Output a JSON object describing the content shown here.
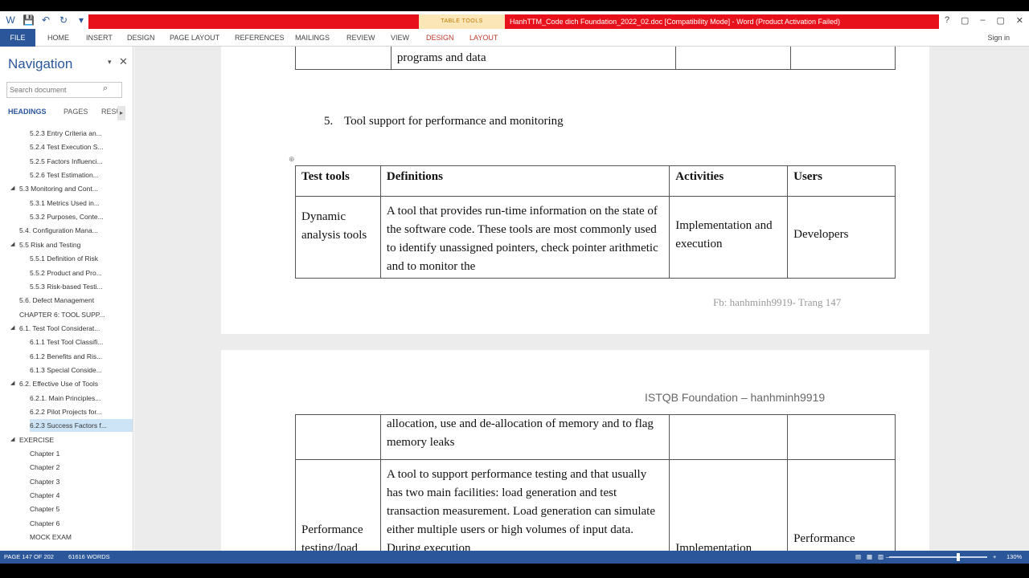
{
  "window": {
    "quick_access": [
      "W",
      "💾",
      "↶",
      "↻",
      "▾"
    ],
    "context_tab_group": "TABLE TOOLS",
    "title": "HanhTTM_Code dich Foundation_2022_02.doc [Compatibility Mode] - Word (Product Activation Failed)",
    "controls": [
      "?",
      "▢",
      "–",
      "▢",
      "✕"
    ]
  },
  "ribbon": {
    "file": "FILE",
    "tabs": [
      "HOME",
      "INSERT",
      "DESIGN",
      "PAGE LAYOUT",
      "REFERENCES",
      "MAILINGS",
      "REVIEW",
      "VIEW"
    ],
    "context_tabs": [
      "DESIGN",
      "LAYOUT"
    ],
    "signin": "Sign in"
  },
  "navigation": {
    "title": "Navigation",
    "pin": "▾",
    "close": "✕",
    "search_placeholder": "Search document",
    "tabs": [
      "HEADINGS",
      "PAGES",
      "RESU"
    ],
    "items": [
      {
        "label": "5.2.3 Entry Criteria an...",
        "level": 2,
        "tri": ""
      },
      {
        "label": "5.2.4 Test Execution S...",
        "level": 2,
        "tri": ""
      },
      {
        "label": "5.2.5 Factors Influenci...",
        "level": 2,
        "tri": ""
      },
      {
        "label": "5.2.6 Test Estimation...",
        "level": 2,
        "tri": ""
      },
      {
        "label": "5.3 Monitoring and Cont...",
        "level": 1,
        "tri": "◢"
      },
      {
        "label": "5.3.1 Metrics Used in...",
        "level": 2,
        "tri": ""
      },
      {
        "label": "5.3.2 Purposes, Conte...",
        "level": 2,
        "tri": ""
      },
      {
        "label": "5.4. Configuration Mana...",
        "level": 1,
        "tri": ""
      },
      {
        "label": "5.5 Risk and Testing",
        "level": 1,
        "tri": "◢"
      },
      {
        "label": "5.5.1 Definition of Risk",
        "level": 2,
        "tri": ""
      },
      {
        "label": "5.5.2 Product and Pro...",
        "level": 2,
        "tri": ""
      },
      {
        "label": "5.5.3 Risk-based Testi...",
        "level": 2,
        "tri": ""
      },
      {
        "label": "5.6. Defect Management",
        "level": 1,
        "tri": ""
      },
      {
        "label": "CHAPTER 6: TOOL SUPP...",
        "level": 1,
        "tri": ""
      },
      {
        "label": "6.1. Test Tool Considerat...",
        "level": 1,
        "tri": "◢"
      },
      {
        "label": "6.1.1 Test Tool Classifi...",
        "level": 2,
        "tri": ""
      },
      {
        "label": "6.1.2 Benefits and Ris...",
        "level": 2,
        "tri": ""
      },
      {
        "label": "6.1.3 Special Conside...",
        "level": 2,
        "tri": ""
      },
      {
        "label": "6.2. Effective Use of Tools",
        "level": 1,
        "tri": "◢"
      },
      {
        "label": "6.2.1. Main Principles...",
        "level": 2,
        "tri": ""
      },
      {
        "label": "6.2.2 Pilot Projects for...",
        "level": 2,
        "tri": ""
      },
      {
        "label": "6.2.3 Success Factors f...",
        "level": 2,
        "tri": "",
        "selected": true
      },
      {
        "label": "EXERCISE",
        "level": 1,
        "tri": "◢"
      },
      {
        "label": "Chapter 1",
        "level": 2,
        "tri": ""
      },
      {
        "label": "Chapter 2",
        "level": 2,
        "tri": ""
      },
      {
        "label": "Chapter 3",
        "level": 2,
        "tri": ""
      },
      {
        "label": "Chapter 4",
        "level": 2,
        "tri": ""
      },
      {
        "label": "Chapter 5",
        "level": 2,
        "tri": ""
      },
      {
        "label": "Chapter 6",
        "level": 2,
        "tri": ""
      },
      {
        "label": "MOCK EXAM",
        "level": 2,
        "tri": ""
      }
    ]
  },
  "page1": {
    "prev_row_text": "programs and data",
    "heading_number": "5.",
    "heading_text": "Tool support for performance and monitoring",
    "table_move_icon": "⊕",
    "headers": [
      "Test tools",
      "Definitions",
      "Activities",
      "Users"
    ],
    "row": {
      "tool": "Dynamic analysis tools",
      "definition": "A tool that provides run-time information on the state of the software code. These tools are most commonly used to identify unassigned pointers, check pointer arithmetic and to monitor the",
      "activity": "Implementation and execution",
      "users": "Developers"
    },
    "footer": "Fb: hanhminh9919- Trang 147"
  },
  "page2": {
    "header": "ISTQB Foundation – hanhminh9919",
    "cont_text": "allocation, use and de-allocation of memory and to flag memory leaks",
    "row": {
      "tool": "Performance testing/load",
      "definition": "A tool to support performance testing and that usually has two main facilities: load generation and test transaction measurement. Load generation can simulate either multiple users or high volumes of input data. During execution",
      "activity": "Implementation",
      "users": "Performance"
    }
  },
  "status": {
    "page": "PAGE 147 OF 202",
    "words": "61616 WORDS",
    "zoom": "130%",
    "zoom_minus": "–",
    "zoom_plus": "+",
    "view_icons": [
      "▤",
      "▦",
      "▥"
    ]
  }
}
